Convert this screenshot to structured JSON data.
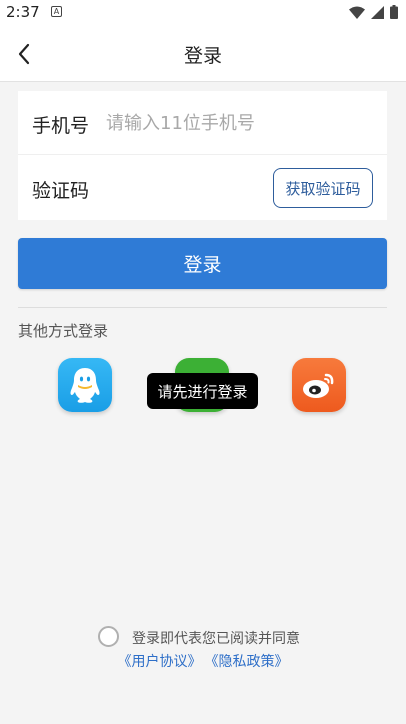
{
  "status_bar": {
    "time": "2:37",
    "notification_icon": "A",
    "icons": [
      "wifi-icon",
      "signal-icon",
      "battery-icon"
    ]
  },
  "header": {
    "title": "登录",
    "back_icon": "chevron-left-icon"
  },
  "form": {
    "phone_label": "手机号",
    "phone_placeholder": "请输入11位手机号",
    "phone_value": "",
    "code_label": "验证码",
    "get_code_label": "获取验证码"
  },
  "login_button_label": "登录",
  "other_methods": {
    "label": "其他方式登录",
    "providers": [
      "qq-icon",
      "wechat-icon",
      "weibo-icon"
    ]
  },
  "toast": "请先进行登录",
  "agreement": {
    "text": "登录即代表您已阅读并同意",
    "checked": false,
    "user_agreement": "《用户协议》",
    "privacy_policy": "《隐私政策》"
  },
  "colors": {
    "primary": "#2f7bd6",
    "link": "#2e6fc8",
    "code_border": "#2e5d9c",
    "background": "#f4f4f4"
  }
}
